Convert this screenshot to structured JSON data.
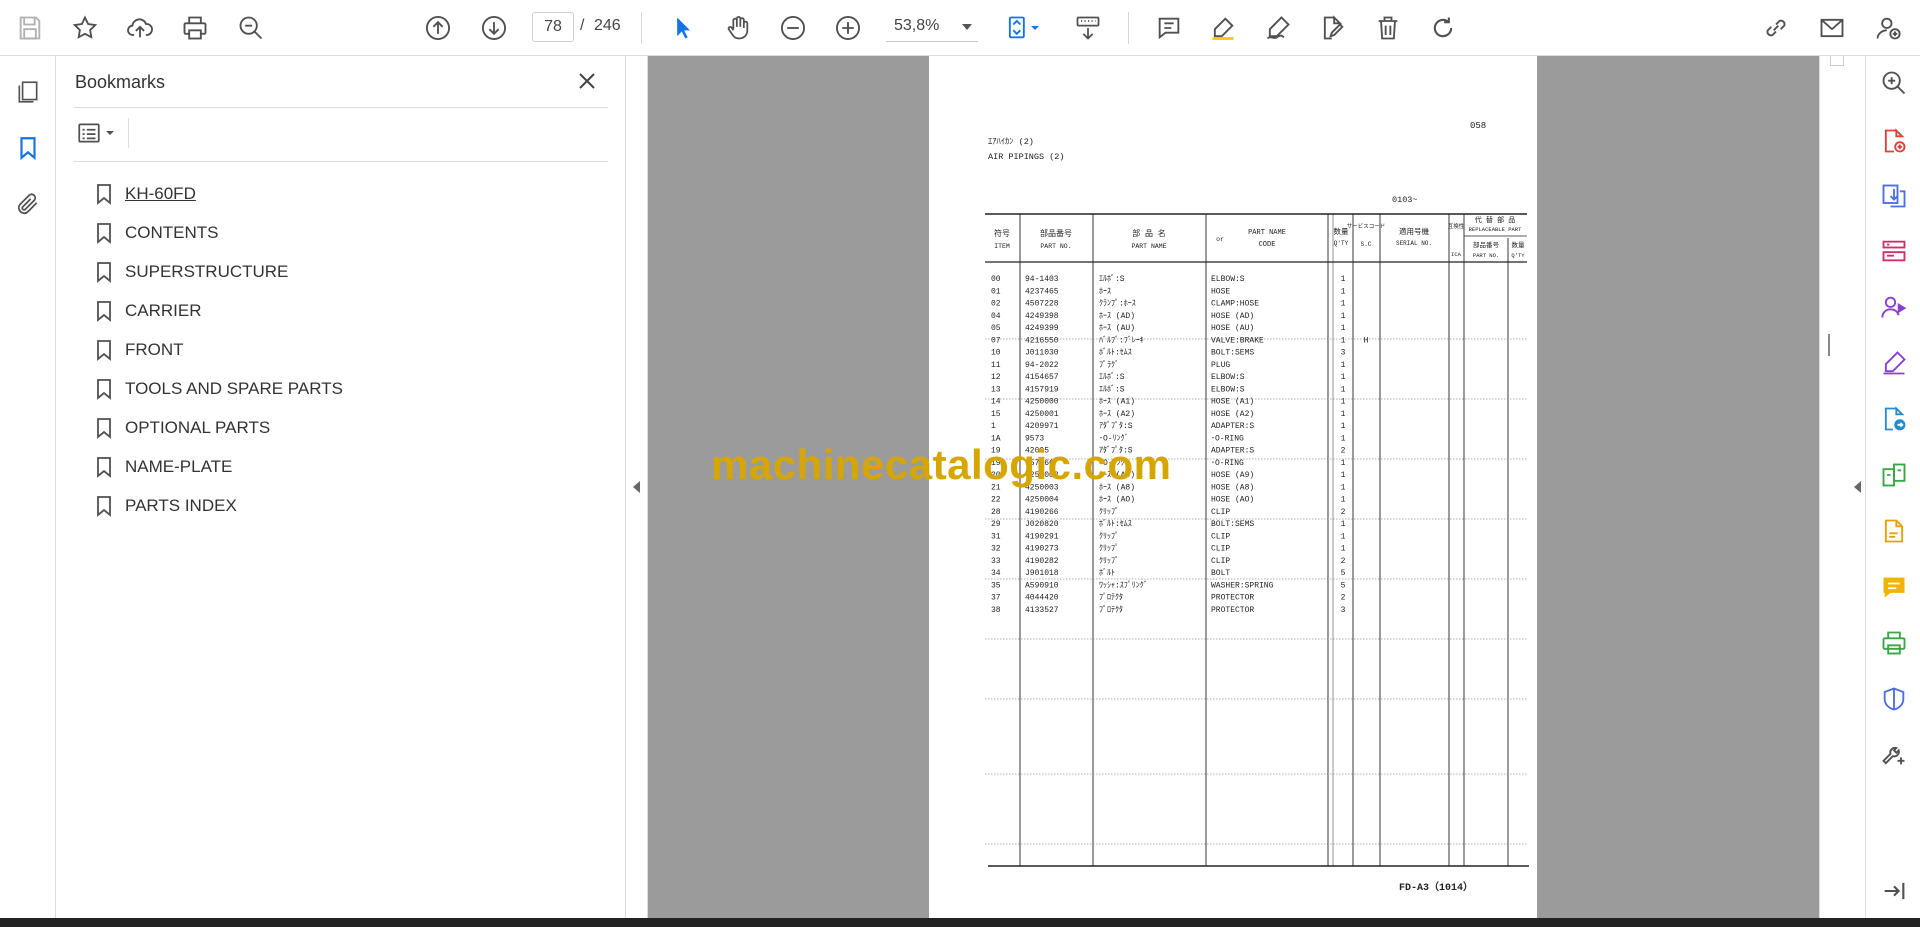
{
  "toolbar": {
    "page_current": "78",
    "page_separator": "/",
    "page_total": "246",
    "zoom": "53,8%"
  },
  "bookmarks": {
    "title": "Bookmarks",
    "items": [
      {
        "label": "KH-60FD"
      },
      {
        "label": "CONTENTS"
      },
      {
        "label": "SUPERSTRUCTURE"
      },
      {
        "label": "CARRIER"
      },
      {
        "label": "FRONT"
      },
      {
        "label": "TOOLS AND SPARE PARTS"
      },
      {
        "label": "OPTIONAL PARTS"
      },
      {
        "label": "NAME-PLATE"
      },
      {
        "label": "PARTS INDEX"
      }
    ]
  },
  "document": {
    "page_no": "058",
    "title_jp": "ｴｱﾊｲｶﾝ (2)",
    "title_en": "AIR PIPINGS (2)",
    "serial_range": "0103~",
    "headers": {
      "item_jp": "符号",
      "item_en": "ITEM",
      "partno_jp": "部品番号",
      "partno_en": "PART NO.",
      "name_jp": "部 品 名",
      "name_en": "PART NAME",
      "or": "or",
      "code_a": "PART NAME",
      "code_b": "CODE",
      "qty_jp": "数量",
      "qty_en": "Q'TY",
      "sc_jp": "サービスコード",
      "sc_en": "S.C",
      "serial_jp": "適用号機",
      "serial_en": "SERIAL NO.",
      "ica_jp": "互換性",
      "ica_en": "ICA",
      "repl_jp": "代 替 部 品",
      "repl_en": "REPLACEABLE PART",
      "repl_partno_jp": "部品番号",
      "repl_partno_en": "PART NO.",
      "repl_qty_jp": "数量",
      "repl_qty_en": "Q'TY"
    },
    "rows": [
      {
        "item": "00",
        "part": "94-1403",
        "jp": "ｴﾙﾎﾞ:S",
        "en": "ELBOW:S",
        "qty": "1",
        "sc": ""
      },
      {
        "item": "01",
        "part": "4237465",
        "jp": "ﾎｰｽ",
        "en": "HOSE",
        "qty": "1",
        "sc": ""
      },
      {
        "item": "02",
        "part": "4507228",
        "jp": "ｸﾗﾝﾌﾟ:ﾎｰｽ",
        "en": "CLAMP:HOSE",
        "qty": "1",
        "sc": ""
      },
      {
        "item": "04",
        "part": "4249398",
        "jp": "ﾎｰｽ (AD)",
        "en": "HOSE (AD)",
        "qty": "1",
        "sc": ""
      },
      {
        "item": "05",
        "part": "4249399",
        "jp": "ﾎｰｽ (AU)",
        "en": "HOSE (AU)",
        "qty": "1",
        "sc": ""
      },
      {
        "item": "07",
        "part": "4216550",
        "jp": "ﾊﾞﾙﾌﾞ:ﾌﾞﾚｰｷ",
        "en": "VALVE:BRAKE",
        "qty": "1",
        "sc": "H"
      },
      {
        "item": "10",
        "part": "J011030",
        "jp": "ﾎﾞﾙﾄ:ｾﾑｽ",
        "en": "BOLT:SEMS",
        "qty": "3",
        "sc": ""
      },
      {
        "item": "11",
        "part": "94-2022",
        "jp": "ﾌﾟﾗｸﾞ",
        "en": "PLUG",
        "qty": "1",
        "sc": ""
      },
      {
        "item": "12",
        "part": "4154657",
        "jp": "ｴﾙﾎﾞ:S",
        "en": "ELBOW:S",
        "qty": "1",
        "sc": ""
      },
      {
        "item": "13",
        "part": "4157919",
        "jp": "ｴﾙﾎﾞ:S",
        "en": "ELBOW:S",
        "qty": "1",
        "sc": ""
      },
      {
        "item": "14",
        "part": "4250000",
        "jp": "ﾎｰｽ (A1)",
        "en": "HOSE (A1)",
        "qty": "1",
        "sc": ""
      },
      {
        "item": "15",
        "part": "4250001",
        "jp": "ﾎｰｽ (A2)",
        "en": "HOSE (A2)",
        "qty": "1",
        "sc": ""
      },
      {
        "item": "1",
        "part": "4209971",
        "jp": "ｱﾀﾞﾌﾟﾀ:S",
        "en": "ADAPTER:S",
        "qty": "1",
        "sc": ""
      },
      {
        "item": "1A",
        "part": "9573",
        "jp": "･O-ﾘﾝｸﾞ",
        "en": "･O-RING",
        "qty": "1",
        "sc": ""
      },
      {
        "item": "19",
        "part": "42005",
        "jp": "ｱﾀﾞﾌﾟﾀ:S",
        "en": "ADAPTER:S",
        "qty": "2",
        "sc": ""
      },
      {
        "item": "19A",
        "part": "957366",
        "jp": "･O-ﾘﾝｸﾞ",
        "en": "･O-RING",
        "qty": "1",
        "sc": ""
      },
      {
        "item": "20",
        "part": "4250002",
        "jp": "ﾎｰｽ (A9)",
        "en": "HOSE (A9)",
        "qty": "1",
        "sc": ""
      },
      {
        "item": "21",
        "part": "4250003",
        "jp": "ﾎｰｽ (A8)",
        "en": "HOSE (A8)",
        "qty": "1",
        "sc": ""
      },
      {
        "item": "22",
        "part": "4250004",
        "jp": "ﾎｰｽ (AO)",
        "en": "HOSE (AO)",
        "qty": "1",
        "sc": ""
      },
      {
        "item": "28",
        "part": "4190266",
        "jp": "ｸﾘｯﾌﾟ",
        "en": "CLIP",
        "qty": "2",
        "sc": ""
      },
      {
        "item": "29",
        "part": "J020820",
        "jp": "ﾎﾞﾙﾄ:ｾﾑｽ",
        "en": "BOLT:SEMS",
        "qty": "1",
        "sc": ""
      },
      {
        "item": "31",
        "part": "4190291",
        "jp": "ｸﾘｯﾌﾟ",
        "en": "CLIP",
        "qty": "1",
        "sc": ""
      },
      {
        "item": "32",
        "part": "4190273",
        "jp": "ｸﾘｯﾌﾟ",
        "en": "CLIP",
        "qty": "1",
        "sc": ""
      },
      {
        "item": "33",
        "part": "4190282",
        "jp": "ｸﾘｯﾌﾟ",
        "en": "CLIP",
        "qty": "2",
        "sc": ""
      },
      {
        "item": "34",
        "part": "J901018",
        "jp": "ﾎﾞﾙﾄ",
        "en": "BOLT",
        "qty": "5",
        "sc": ""
      },
      {
        "item": "35",
        "part": "A590910",
        "jp": "ﾜｯｼｬ:ｽﾌﾟﾘﾝｸﾞ",
        "en": "WASHER:SPRING",
        "qty": "5",
        "sc": ""
      },
      {
        "item": "37",
        "part": "4044420",
        "jp": "ﾌﾟﾛﾃｸﾀ",
        "en": "PROTECTOR",
        "qty": "2",
        "sc": ""
      },
      {
        "item": "38",
        "part": "4133527",
        "jp": "ﾌﾟﾛﾃｸﾀ",
        "en": "PROTECTOR",
        "qty": "3",
        "sc": ""
      }
    ],
    "footer_code": "FD-A3（1014）",
    "watermark": "machinecatalogic.com"
  },
  "colors": {
    "accent": "#1473e6",
    "toolbar_icon": "#505050",
    "watermark": "#d6a500",
    "viewer_bg": "#9b9b9b"
  }
}
